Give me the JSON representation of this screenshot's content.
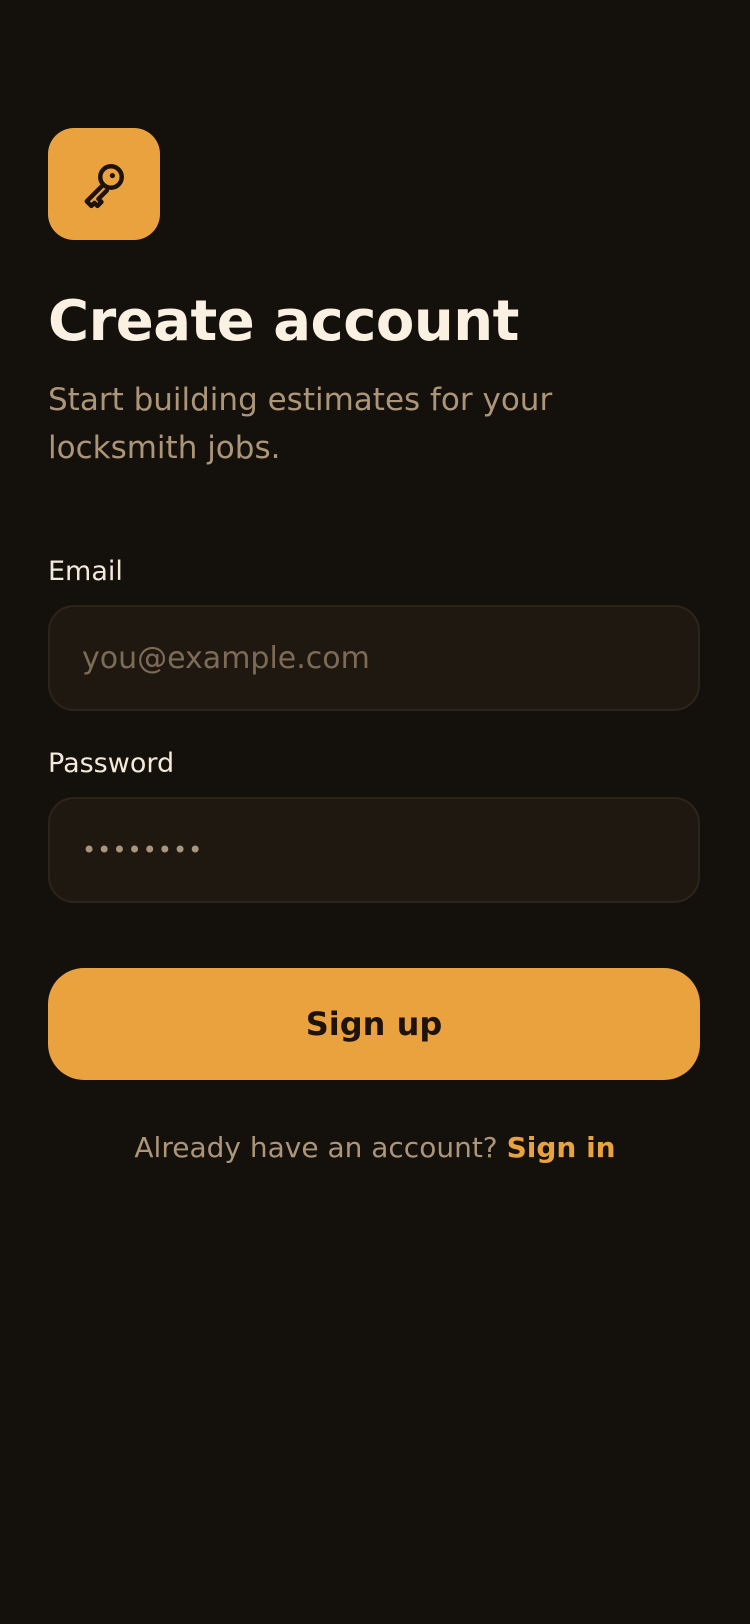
{
  "theme": {
    "background": "#14100b",
    "accent": "#e9a23e",
    "title_color": "#fbf1e3",
    "muted_text": "#ad9578",
    "field_background": "#1f1811",
    "field_border": "#2d241a"
  },
  "header": {
    "app_icon": "key-icon",
    "title": "Create account",
    "subtitle": "Start building estimates for your locksmith jobs."
  },
  "form": {
    "email": {
      "label": "Email",
      "value": "",
      "placeholder": "you@example.com"
    },
    "password": {
      "label": "Password",
      "value": "••••••••"
    },
    "submit_label": "Sign up"
  },
  "footer": {
    "prompt": "Already have an account?",
    "link_label": "Sign in"
  }
}
